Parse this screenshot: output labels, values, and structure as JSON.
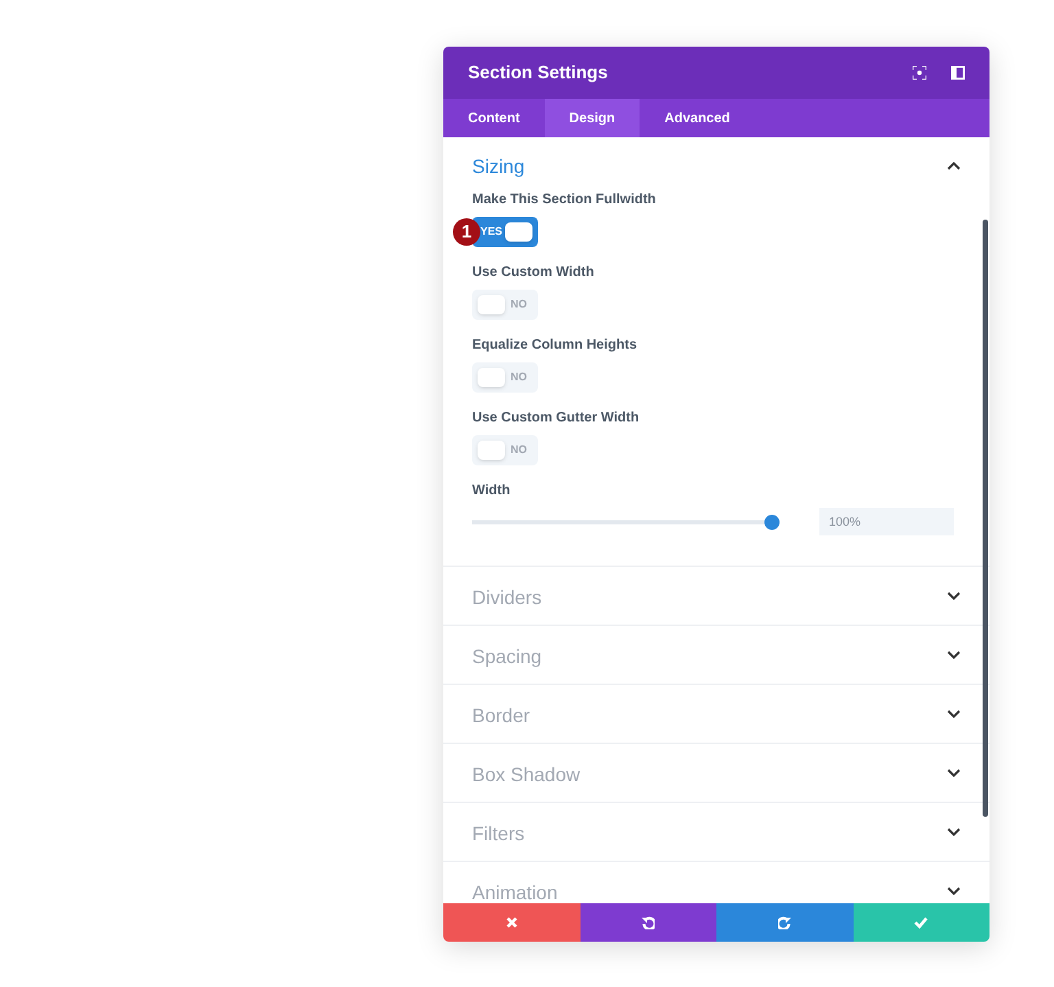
{
  "window": {
    "title": "Section Settings"
  },
  "tabs": [
    {
      "label": "Content",
      "selected": false
    },
    {
      "label": "Design",
      "selected": true
    },
    {
      "label": "Advanced",
      "selected": false
    }
  ],
  "sections": [
    {
      "title": "Sizing",
      "expanded": true,
      "fields": [
        {
          "kind": "toggle",
          "label": "Make This Section Fullwidth",
          "on": true,
          "text": "YES",
          "callout": "1"
        },
        {
          "kind": "toggle",
          "label": "Use Custom Width",
          "on": false,
          "text": "NO"
        },
        {
          "kind": "toggle",
          "label": "Equalize Column Heights",
          "on": false,
          "text": "NO"
        },
        {
          "kind": "toggle",
          "label": "Use Custom Gutter Width",
          "on": false,
          "text": "NO"
        },
        {
          "kind": "slider",
          "label": "Width",
          "level": 1,
          "value": "100%"
        }
      ]
    },
    {
      "title": "Dividers",
      "expanded": false
    },
    {
      "title": "Spacing",
      "expanded": false
    },
    {
      "title": "Border",
      "expanded": false
    },
    {
      "title": "Box Shadow",
      "expanded": false
    },
    {
      "title": "Filters",
      "expanded": false
    },
    {
      "title": "Animation",
      "expanded": false
    }
  ],
  "footer": [
    {
      "kind": "cancel"
    },
    {
      "kind": "undo"
    },
    {
      "kind": "redo"
    },
    {
      "kind": "save"
    }
  ]
}
